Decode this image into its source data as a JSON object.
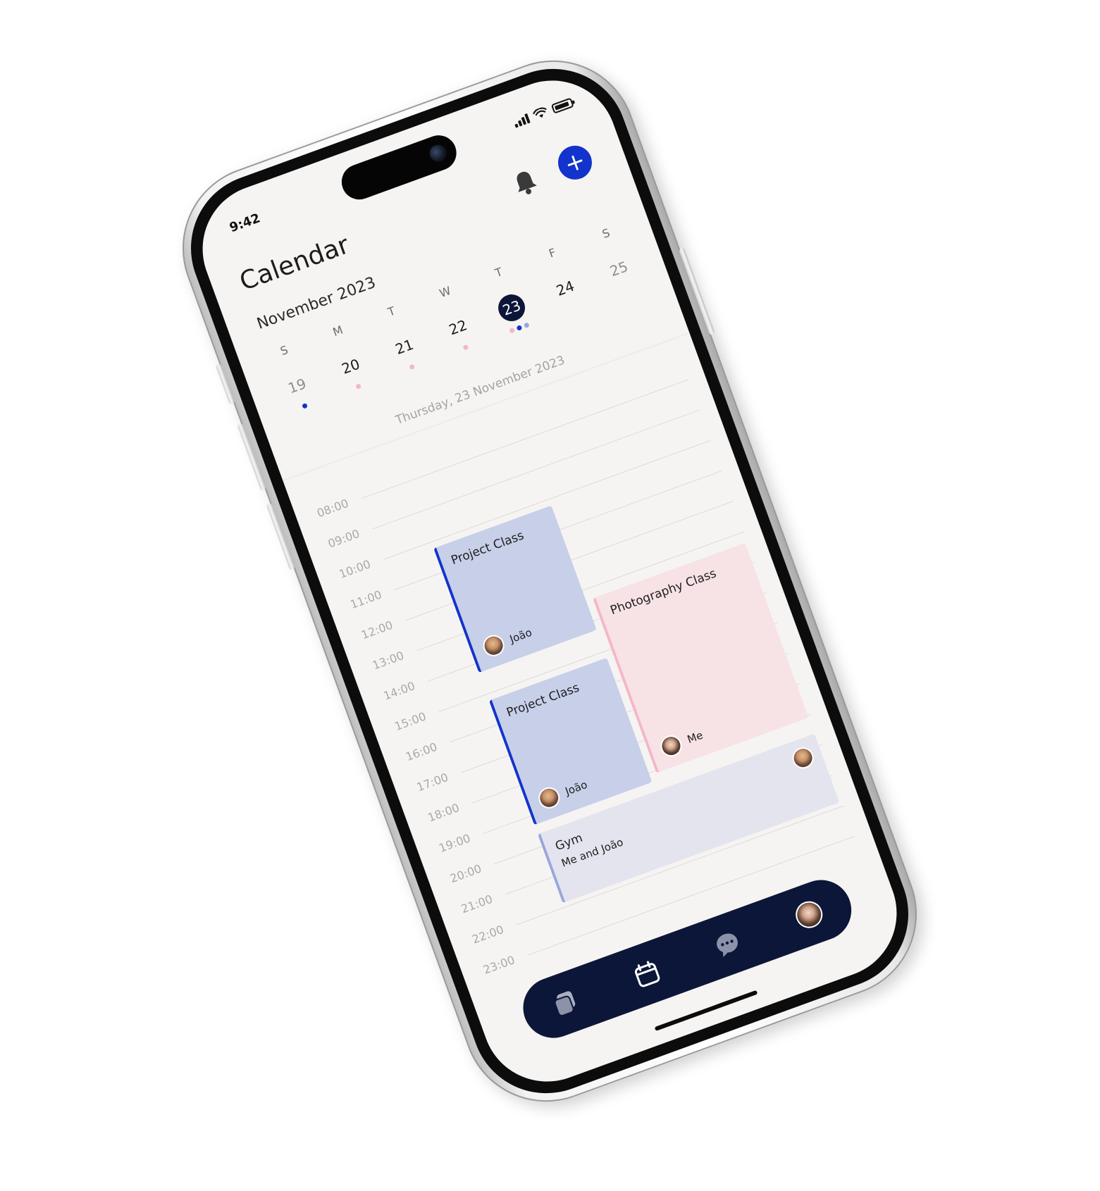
{
  "status": {
    "time": "9:42"
  },
  "header": {
    "title": "Calendar",
    "month": "November 2023",
    "accent_color": "#1233cc"
  },
  "week": [
    {
      "dow": "S",
      "num": "19",
      "muted": true,
      "dots": [
        "#1233cc"
      ]
    },
    {
      "dow": "M",
      "num": "20",
      "muted": false,
      "dots": [
        "#f4b7c7"
      ]
    },
    {
      "dow": "T",
      "num": "21",
      "muted": false,
      "dots": [
        "#f4b7c7"
      ]
    },
    {
      "dow": "W",
      "num": "22",
      "muted": false,
      "dots": [
        "#f4b7c7"
      ]
    },
    {
      "dow": "T",
      "num": "23",
      "muted": false,
      "selected": true,
      "dots": [
        "#f4b7c7",
        "#1233cc",
        "#9aa6dd"
      ]
    },
    {
      "dow": "F",
      "num": "24",
      "muted": false,
      "dots": []
    },
    {
      "dow": "S",
      "num": "25",
      "muted": true,
      "dots": []
    }
  ],
  "selected_date_label": "Thursday, 23 November 2023",
  "hours": [
    "08:00",
    "09:00",
    "10:00",
    "11:00",
    "12:00",
    "13:00",
    "14:00",
    "15:00",
    "16:00",
    "17:00",
    "18:00",
    "19:00",
    "20:00",
    "21:00",
    "22:00",
    "23:00"
  ],
  "events": {
    "project_class_1": {
      "title": "Project Class",
      "person": "João"
    },
    "project_class_2": {
      "title": "Project Class",
      "person": "João"
    },
    "photography_class": {
      "title": "Photography Class",
      "person": "Me"
    },
    "gym": {
      "title": "Gym",
      "subtitle": "Me and João"
    }
  },
  "nav": {
    "items": [
      "cards-icon",
      "calendar-icon",
      "chat-icon",
      "profile-avatar"
    ]
  }
}
